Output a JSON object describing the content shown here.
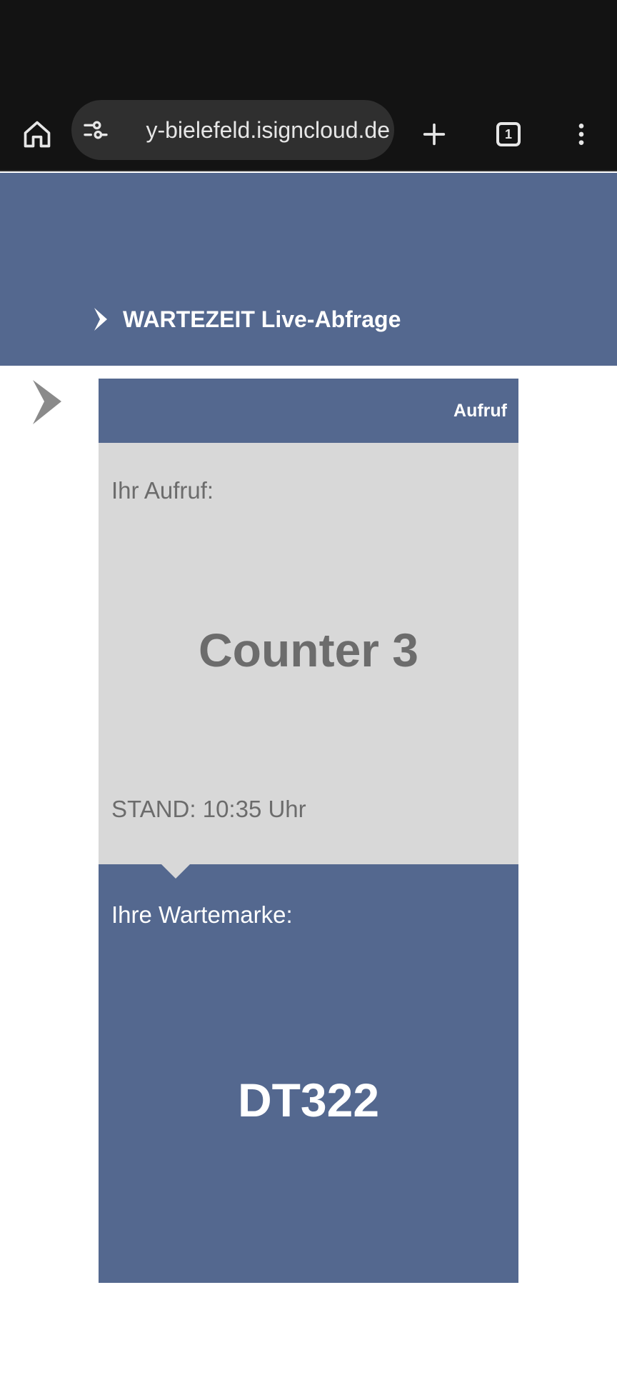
{
  "browser": {
    "url": "y-bielefeld.isigncloud.de",
    "tab_count": "1"
  },
  "header": {
    "link_title": "WARTEZEIT Live-Abfrage"
  },
  "card": {
    "tab_label": "Aufruf",
    "call_label": "Ihr Aufruf:",
    "counter": "Counter 3",
    "stand": "STAND: 10:35 Uhr",
    "ticket_label": "Ihre Wartemarke:",
    "ticket_number": "DT322"
  },
  "colors": {
    "brand_blue": "#54688f",
    "panel_grey": "#d8d8d8",
    "text_grey": "#6c6c6c",
    "browser_dark": "#131313"
  },
  "icons": {
    "home": "home-icon",
    "site_settings": "tune-icon",
    "new_tab": "plus-icon",
    "tabs": "tab-switcher-icon",
    "menu": "more-vert-icon",
    "header_arrow": "chevron-right-icon",
    "side_arrow": "chevron-right-icon"
  }
}
